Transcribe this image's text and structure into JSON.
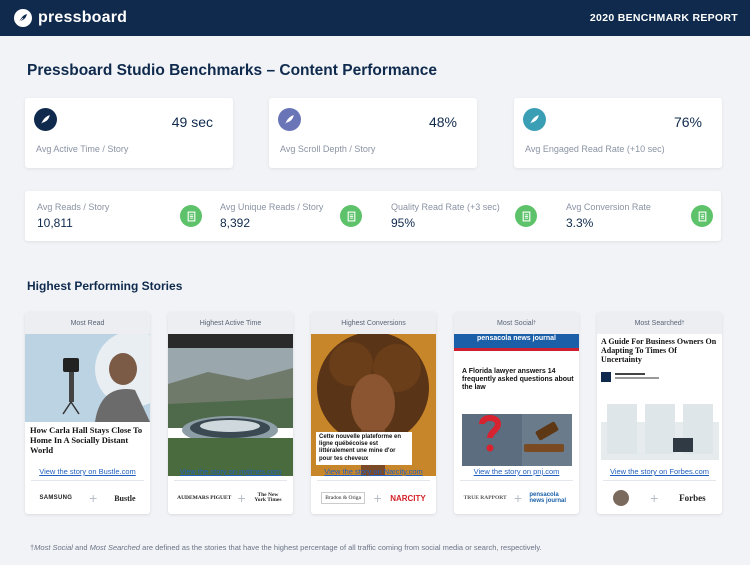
{
  "header": {
    "brand": "pressboard",
    "report_title": "2020 BENCHMARK REPORT"
  },
  "title": "Pressboard Studio Benchmarks – Content Performance",
  "metrics_top": [
    {
      "value": "49 sec",
      "label": "Avg Active Time / Story",
      "icon": "feather-icon",
      "color": "#0f2a4d"
    },
    {
      "value": "48%",
      "label": "Avg Scroll Depth / Story",
      "icon": "feather-icon",
      "color": "#6a75b8"
    },
    {
      "value": "76%",
      "label": "Avg Engaged Read Rate (+10 sec)",
      "icon": "feather-icon",
      "color": "#3a9eb5"
    }
  ],
  "metrics_bottom": [
    {
      "label": "Avg Reads / Story",
      "value": "10,811",
      "icon": "document-icon"
    },
    {
      "label": "Avg Unique Reads / Story",
      "value": "8,392",
      "icon": "document-icon"
    },
    {
      "label": "Quality Read Rate (+3 sec)",
      "value": "95%",
      "icon": "document-icon"
    },
    {
      "label": "Avg Conversion Rate",
      "value": "3.3%",
      "icon": "document-icon"
    }
  ],
  "section_title": "Highest Performing Stories",
  "stories": [
    {
      "category": "Most Read",
      "headline": "How Carla Hall Stays Close To Home In A Socially Distant World",
      "link": "View the story on Bustle.com",
      "brand_logo": "SAMSUNG",
      "publisher_logo": "Bustle"
    },
    {
      "category": "Highest Active Time",
      "headline": "",
      "link": "View the story on nytimes.com",
      "brand_logo": "AUDEMARS PIGUET",
      "publisher_logo": "The New York Times"
    },
    {
      "category": "Highest Conversions",
      "headline": "Cette nouvelle plateforme en ligne québécoise est littéralement une mine d'or pour tes cheveux",
      "link": "View the story on Narcity.com",
      "brand_logo": "Bradon & Origa",
      "publisher_logo": "NARCITY"
    },
    {
      "category": "Most Social",
      "category_sup": "†",
      "masthead": "pensacola news journal",
      "headline": "A Florida lawyer answers 14 frequently asked questions about the law",
      "link": "View the story on pnj.com",
      "brand_logo": "TRUE RAPPORT",
      "publisher_logo": "pensacola news journal"
    },
    {
      "category": "Most Searched",
      "category_sup": "†",
      "headline": "A Guide For Business Owners On Adapting To Times Of Uncertainty",
      "link": "View the story on Forbes.com",
      "brand_logo": "",
      "publisher_logo": "Forbes"
    }
  ],
  "footnote": {
    "mark": "†",
    "term1": "Most Social",
    "and": " and ",
    "term2": "Most Searched",
    "rest": " are defined as the stories that have the highest percentage of all traffic coming from social media or search, respectively."
  },
  "colors": {
    "navy": "#0f2a4d",
    "green": "#5ec26a",
    "link": "#1f5fbf"
  }
}
